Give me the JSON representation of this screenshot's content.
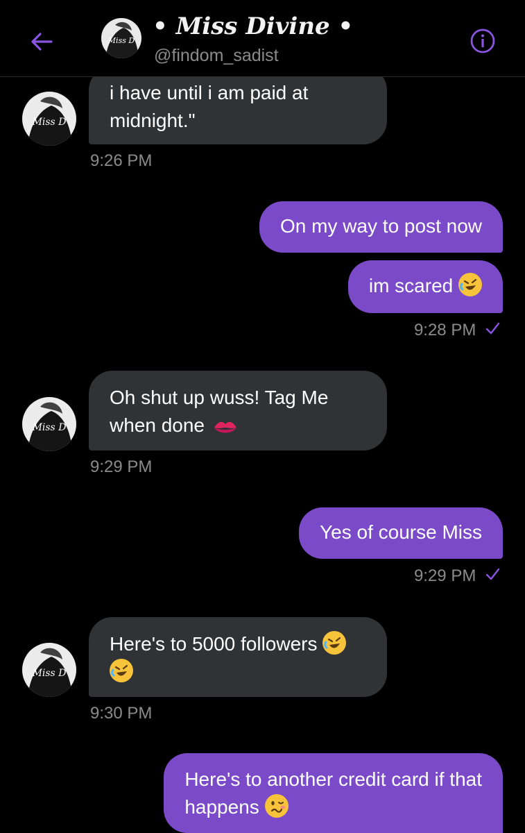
{
  "header": {
    "title": "• Miss Divine •",
    "handle": "@findom_sadist"
  },
  "messages": [
    {
      "side": "in",
      "text": "i have until i am paid at midnight.\"",
      "line1": "i have until i am paid at",
      "line2": "midnight.\"",
      "time": "9:26 PM"
    },
    {
      "side": "out",
      "text": "On my way to post now"
    },
    {
      "side": "out",
      "text": "im scared",
      "emoji": "rolling-on-floor-laughing",
      "time": "9:28 PM"
    },
    {
      "side": "in",
      "line1": "Oh shut up wuss! Tag Me",
      "line2": "when done",
      "emoji": "kiss-mark",
      "time": "9:29 PM"
    },
    {
      "side": "out",
      "text": "Yes of course Miss",
      "time": "9:29 PM"
    },
    {
      "side": "in",
      "line1": "Here's to 5000 followers",
      "emoji": "rolling-on-floor-laughing",
      "time": "9:30 PM"
    },
    {
      "side": "out",
      "line1": "Here's to another credit card if that",
      "line2": "happens",
      "emoji": "woozy-face"
    }
  ],
  "colors": {
    "accent": "#7b4ac8",
    "incoming_bubble": "#2f3336",
    "background": "#000000",
    "meta_text": "#8b8b8b"
  }
}
